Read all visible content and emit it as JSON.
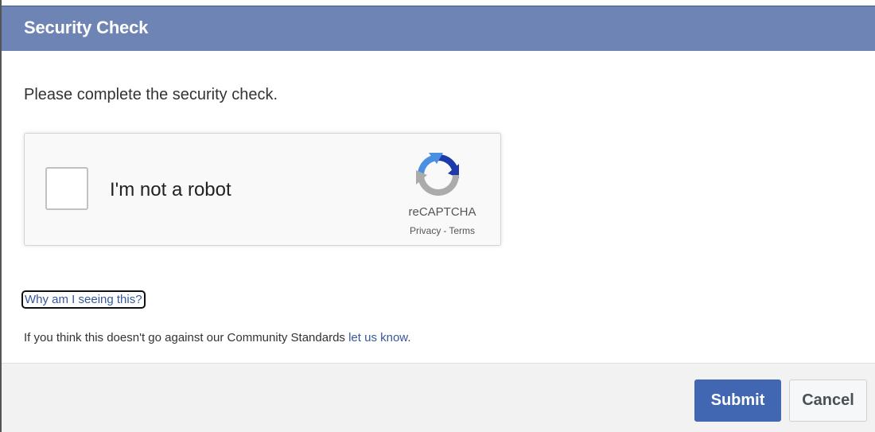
{
  "dialog": {
    "title": "Security Check"
  },
  "content": {
    "instruction": "Please complete the security check.",
    "recaptcha": {
      "checkbox_label": "I'm not a robot",
      "brand": "reCAPTCHA",
      "privacy_link": "Privacy",
      "separator": "-",
      "terms_link": "Terms",
      "checked": false
    },
    "why_link": "Why am I seeing this?",
    "note_text": "If you think this doesn't go against our Community Standards ",
    "note_link": "let us know",
    "note_end": "."
  },
  "footer": {
    "submit_label": "Submit",
    "cancel_label": "Cancel"
  },
  "colors": {
    "header_bg": "#6d84b4",
    "submit_bg": "#4267b2",
    "link": "#365899"
  }
}
